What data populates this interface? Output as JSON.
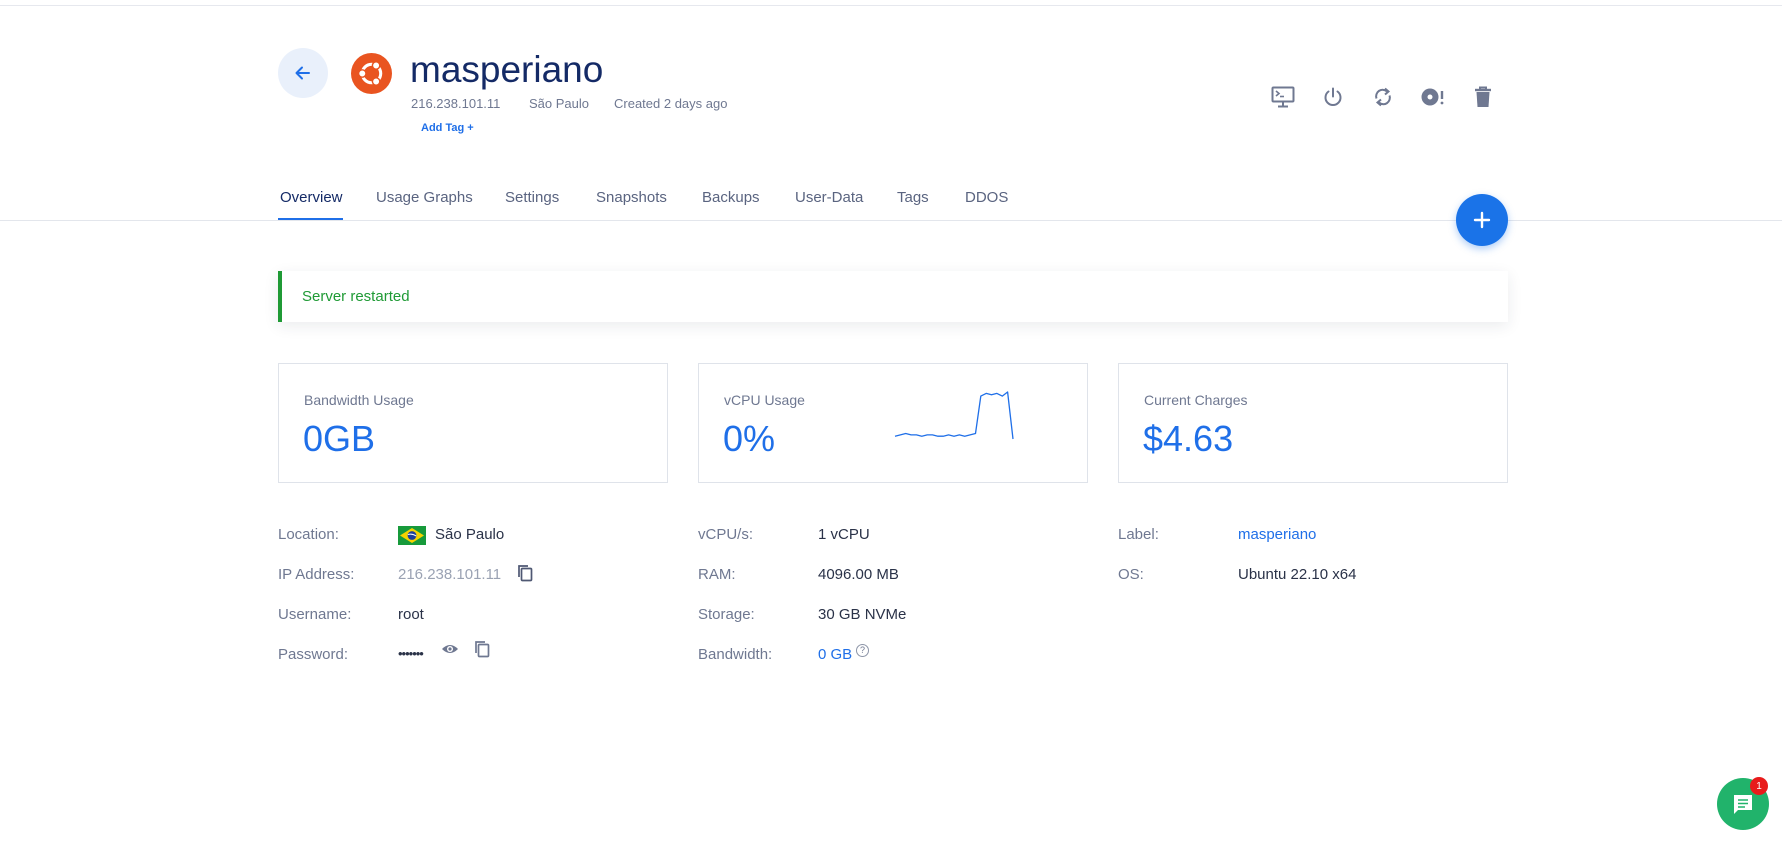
{
  "server": {
    "name": "masperiano",
    "ip": "216.238.101.11",
    "location": "São Paulo",
    "created": "Created 2 days ago",
    "add_tag": "Add Tag +"
  },
  "header_actions": [
    {
      "name": "console",
      "icon": "monitor-console-icon"
    },
    {
      "name": "power",
      "icon": "power-icon"
    },
    {
      "name": "restart",
      "icon": "restart-icon"
    },
    {
      "name": "iso",
      "icon": "disc-icon"
    },
    {
      "name": "destroy",
      "icon": "trash-icon"
    }
  ],
  "tabs": [
    {
      "label": "Overview",
      "active": true
    },
    {
      "label": "Usage Graphs"
    },
    {
      "label": "Settings"
    },
    {
      "label": "Snapshots"
    },
    {
      "label": "Backups"
    },
    {
      "label": "User-Data"
    },
    {
      "label": "Tags"
    },
    {
      "label": "DDOS"
    }
  ],
  "alert": {
    "text": "Server restarted",
    "color": "#1f9a35"
  },
  "cards": {
    "bandwidth": {
      "label": "Bandwidth Usage",
      "value": "0GB"
    },
    "vcpu": {
      "label": "vCPU Usage",
      "value": "0%",
      "sparkline": [
        2,
        3,
        4,
        3,
        3,
        2,
        3,
        3,
        2,
        2,
        3,
        2,
        3,
        2,
        3,
        4,
        31,
        33,
        32,
        33,
        31,
        34,
        0
      ]
    },
    "charges": {
      "label": "Current Charges",
      "value": "$4.63"
    }
  },
  "details_left": {
    "location_label": "Location:",
    "location_value": "São Paulo",
    "ip_label": "IP Address:",
    "ip_value": "216.238.101.11",
    "username_label": "Username:",
    "username_value": "root",
    "password_label": "Password:",
    "password_value": "•••••••"
  },
  "details_mid": {
    "vcpu_label": "vCPU/s:",
    "vcpu_value": "1 vCPU",
    "ram_label": "RAM:",
    "ram_value": "4096.00 MB",
    "storage_label": "Storage:",
    "storage_value": "30 GB NVMe",
    "bandwidth_label": "Bandwidth:",
    "bandwidth_value": "0 GB",
    "help": "?"
  },
  "details_right": {
    "label_label": "Label:",
    "label_value": "masperiano",
    "os_label": "OS:",
    "os_value": "Ubuntu 22.10 x64"
  },
  "chat": {
    "badge": "1"
  },
  "colors": {
    "accent": "#1f6fe8",
    "title": "#142a66",
    "success": "#1f9a35",
    "ubuntu": "#e95420",
    "chat": "#21b36b"
  }
}
